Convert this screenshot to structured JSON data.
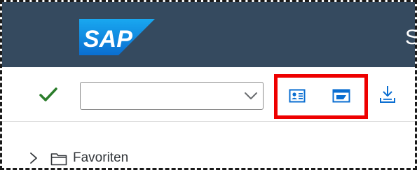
{
  "header": {
    "logo_text": "SAP",
    "title_partial": "S",
    "background_color": "#354a5f",
    "logo_color": "#0a6ed1"
  },
  "toolbar": {
    "ok_icon": "checkmark-icon",
    "ok_color": "#2b7d2b",
    "command_field": {
      "value": "",
      "placeholder": ""
    },
    "highlighted_buttons": [
      {
        "icon": "user-menu-icon"
      },
      {
        "icon": "create-session-icon"
      }
    ],
    "highlight_color": "#ee0000",
    "download_icon": "download-icon",
    "icon_color": "#0a6ed1"
  },
  "navigation": {
    "items": [
      {
        "label": "Favoriten",
        "icon": "folder-icon",
        "expanded": false
      }
    ]
  }
}
